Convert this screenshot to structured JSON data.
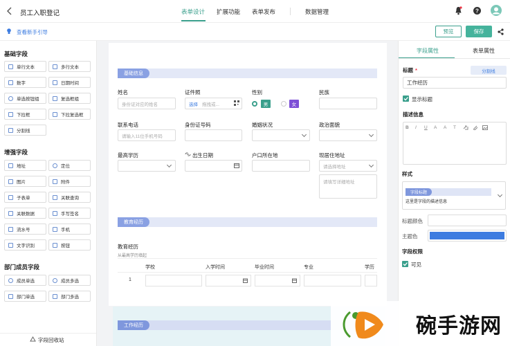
{
  "header": {
    "back_icon": "chevron-left-icon",
    "title": "员工入职登记",
    "tabs": [
      "表单设计",
      "扩展功能",
      "表单发布",
      "数据管理"
    ],
    "active_tab": 0,
    "accent": "#3a9f8c",
    "icons": [
      "notification-icon",
      "help-icon",
      "avatar"
    ]
  },
  "subbar": {
    "guide": "查看新手引导",
    "preview": "预览",
    "save": "保存",
    "share_icon": "share-icon"
  },
  "left": {
    "groups": [
      {
        "title": "基础字段",
        "items": [
          "单行文本",
          "多行文本",
          "数字",
          "日期时间",
          "单选按钮组",
          "复选框组",
          "下拉框",
          "下拉复选框",
          "分割线"
        ]
      },
      {
        "title": "增强字段",
        "items": [
          "地址",
          "定位",
          "图片",
          "附件",
          "子表单",
          "关联查询",
          "关联数据",
          "手写签名",
          "流水号",
          "手机",
          "文字识别",
          "按钮"
        ]
      },
      {
        "title": "部门成员字段",
        "items": [
          "成员单选",
          "成员多选",
          "部门单选",
          "部门多选"
        ]
      }
    ],
    "recycle": "字段回收站"
  },
  "form": {
    "sec1": "基础信息",
    "name_label": "姓名",
    "name_ph": "身份证对应的姓名",
    "photo_label": "证件照",
    "photo_choose": "选择",
    "photo_ph": "拖拽或...",
    "gender_label": "性别",
    "male": "男",
    "female": "女",
    "ethnic_label": "民族",
    "phone_label": "联系电话",
    "phone_ph": "请输入11位手机号码",
    "id_label": "身份证号码",
    "marital_label": "婚姻状况",
    "political_label": "政治面貌",
    "edu_label": "最高学历",
    "birth_label": "出生日期",
    "hukou_label": "户口所在地",
    "addr_label": "现居住地址",
    "addr_ph": "请选择地址",
    "addr_detail_ph": "请填写详细地址",
    "sec2": "教育经历",
    "edu_sub_label": "教育经历",
    "edu_sub_desc": "从最高学历填起",
    "cols": [
      "学校",
      "入学时间",
      "毕业时间",
      "专业",
      "学历"
    ],
    "row_no": "1",
    "sec3": "工作经历"
  },
  "right": {
    "tabs": [
      "字段属性",
      "表单属性"
    ],
    "title_label": "标题",
    "title_value": "工作经历",
    "divider_btn": "分割线",
    "show_title": "显示标题",
    "desc_label": "描述信息",
    "toolbar": [
      "B",
      "I",
      "U",
      "A",
      "A",
      "T"
    ],
    "style_label": "样式",
    "style_title": "字段标题",
    "style_desc": "这里是字段的描述信息",
    "title_color_label": "标题颜色",
    "theme_color_label": "主题色",
    "theme_color": "#3d7ce0",
    "perm_label": "字段权限",
    "visible": "可见"
  },
  "watermark": {
    "text": "碗手游网"
  }
}
